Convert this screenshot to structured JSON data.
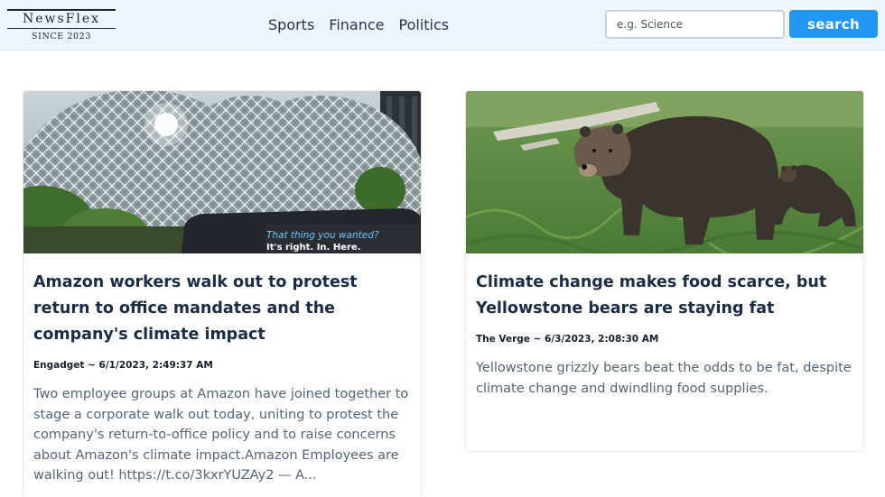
{
  "brand": {
    "name": "NewsFlex",
    "tagline": "SINCE 2023"
  },
  "nav": {
    "items": [
      {
        "label": "Sports"
      },
      {
        "label": "Finance"
      },
      {
        "label": "Politics"
      }
    ]
  },
  "search": {
    "placeholder": "e.g. Science",
    "value": "",
    "button_label": "search"
  },
  "articles": [
    {
      "image": "amazon-spheres-photo",
      "image_caption_line1": "That thing you wanted?",
      "image_caption_line2": "It's right. In. Here.",
      "title": "Amazon workers walk out to protest return to office mandates and the company's climate impact",
      "source_date": "Engadget ~ 6/1/2023, 2:49:37 AM",
      "description": "Two employee groups at Amazon have joined together to stage a corporate walk out today, uniting to protest the company's return-to-office policy and to raise concerns about Amazon's climate impact.Amazon Employees are walking out! https://t.co/3kxrYUZAy2 — A..."
    },
    {
      "image": "grizzly-bears-photo",
      "title": "Climate change makes food scarce, but Yellowstone bears are staying fat",
      "source_date": "The Verge ~ 6/3/2023, 2:08:30 AM",
      "description": "Yellowstone grizzly bears beat the odds to be fat, despite climate change and dwindling food supplies."
    }
  ],
  "colors": {
    "header_bg": "#edf4fb",
    "accent": "#2196f3",
    "title": "#1a2c48",
    "description": "#53657c"
  }
}
